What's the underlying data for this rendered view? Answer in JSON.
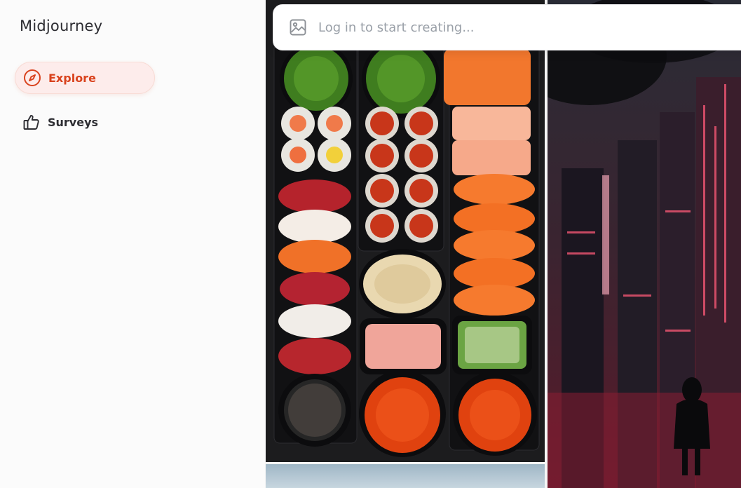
{
  "app": {
    "title": "Midjourney"
  },
  "sidebar": {
    "items": [
      {
        "label": "Explore",
        "icon": "compass-icon",
        "active": true
      },
      {
        "label": "Surveys",
        "icon": "thumbs-up-icon",
        "active": false
      }
    ]
  },
  "prompt": {
    "placeholder": "Log in to start creating...",
    "icon": "image-icon"
  },
  "colors": {
    "accent": "#d9431e",
    "accent_bg": "#fdeceb",
    "background": "#fbfbfb"
  }
}
